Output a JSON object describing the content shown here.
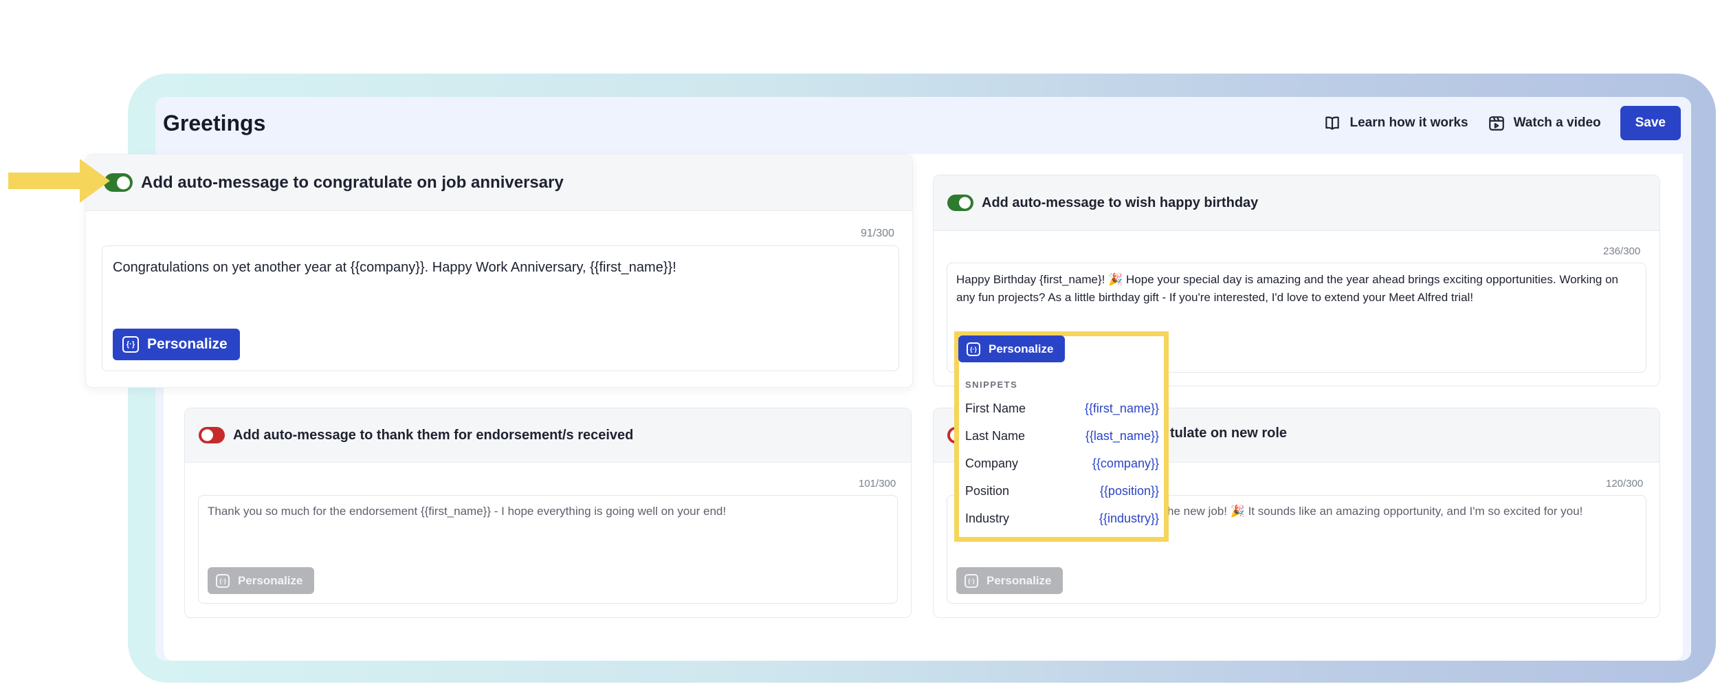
{
  "page": {
    "title": "Greetings",
    "learn_label": "Learn how it works",
    "video_label": "Watch a video",
    "save_label": "Save"
  },
  "cards": {
    "anniversary": {
      "enabled": true,
      "title": "Add auto-message to congratulate on job anniversary",
      "counter": "91/300",
      "message": "Congratulations on yet another year at {{company}}. Happy Work Anniversary, {{first_name}}!",
      "personalize_label": "Personalize"
    },
    "birthday": {
      "enabled": true,
      "title": "Add auto-message to wish happy birthday",
      "counter": "236/300",
      "message": "Happy Birthday {first_name}! 🎉 Hope your special day is amazing and the year ahead brings exciting opportunities. Working on any fun projects? As a little birthday gift - If you're interested, I'd love to extend your Meet Alfred trial!",
      "personalize_label": "Personalize"
    },
    "endorsement": {
      "enabled": false,
      "title": "Add auto-message to thank them for endorsement/s received",
      "counter": "101/300",
      "message": "Thank you so much for the endorsement {{first_name}} - I hope everything is going well on your end!",
      "personalize_label": "Personalize"
    },
    "new_role": {
      "enabled": false,
      "title_visible": "tulate on new role",
      "counter": "120/300",
      "message_visible": "he new job! 🎉 It sounds like an amazing opportunity, and I'm so excited for you!",
      "personalize_label": "Personalize"
    }
  },
  "snippets": {
    "heading": "SNIPPETS",
    "items": [
      {
        "name": "First Name",
        "value": "{{first_name}}"
      },
      {
        "name": "Last Name",
        "value": "{{last_name}}"
      },
      {
        "name": "Company",
        "value": "{{company}}"
      },
      {
        "name": "Position",
        "value": "{{position}}"
      },
      {
        "name": "Industry",
        "value": "{{industry}}"
      }
    ]
  },
  "colors": {
    "accent": "#2a44c8",
    "toggle_on": "#2e7a2e",
    "toggle_off": "#c62a2a",
    "highlight": "#f5d55a"
  },
  "icons": [
    "book-icon",
    "video-camera-icon",
    "personalize-braces-icon",
    "arrow-pointer-icon"
  ]
}
